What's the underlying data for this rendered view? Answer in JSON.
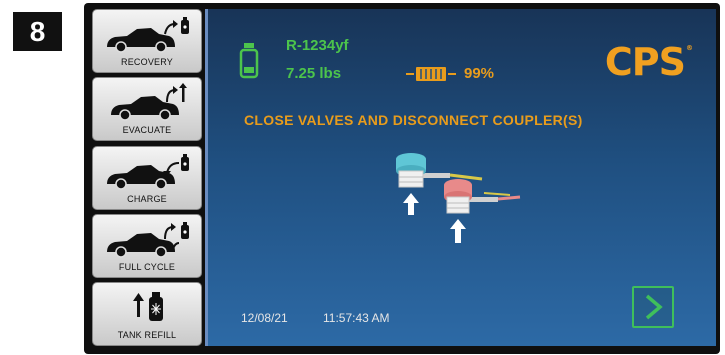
{
  "step": {
    "number": "8"
  },
  "sidebar": {
    "items": [
      {
        "label": "RECOVERY",
        "icon": "car-recovery-icon"
      },
      {
        "label": "EVACUATE",
        "icon": "car-evacuate-icon"
      },
      {
        "label": "CHARGE",
        "icon": "car-charge-icon"
      },
      {
        "label": "FULL CYCLE",
        "icon": "car-full-cycle-icon"
      },
      {
        "label": "TANK REFILL",
        "icon": "tank-refill-icon"
      }
    ]
  },
  "status": {
    "refrigerant": "R-1234yf",
    "weight": "7.25 lbs",
    "battery": "99%"
  },
  "brand": {
    "logo": "CPS",
    "mark": "®"
  },
  "instruction": "CLOSE VALVES AND DISCONNECT COUPLER(S)",
  "footer": {
    "date": "12/08/21",
    "time": "11:57:43 AM"
  },
  "colors": {
    "accent_green": "#4cc44c",
    "accent_orange": "#e89c1c",
    "coupler_low": "#5fc6d6",
    "coupler_high": "#e88a8a",
    "next_button": "#3fbf5b"
  }
}
